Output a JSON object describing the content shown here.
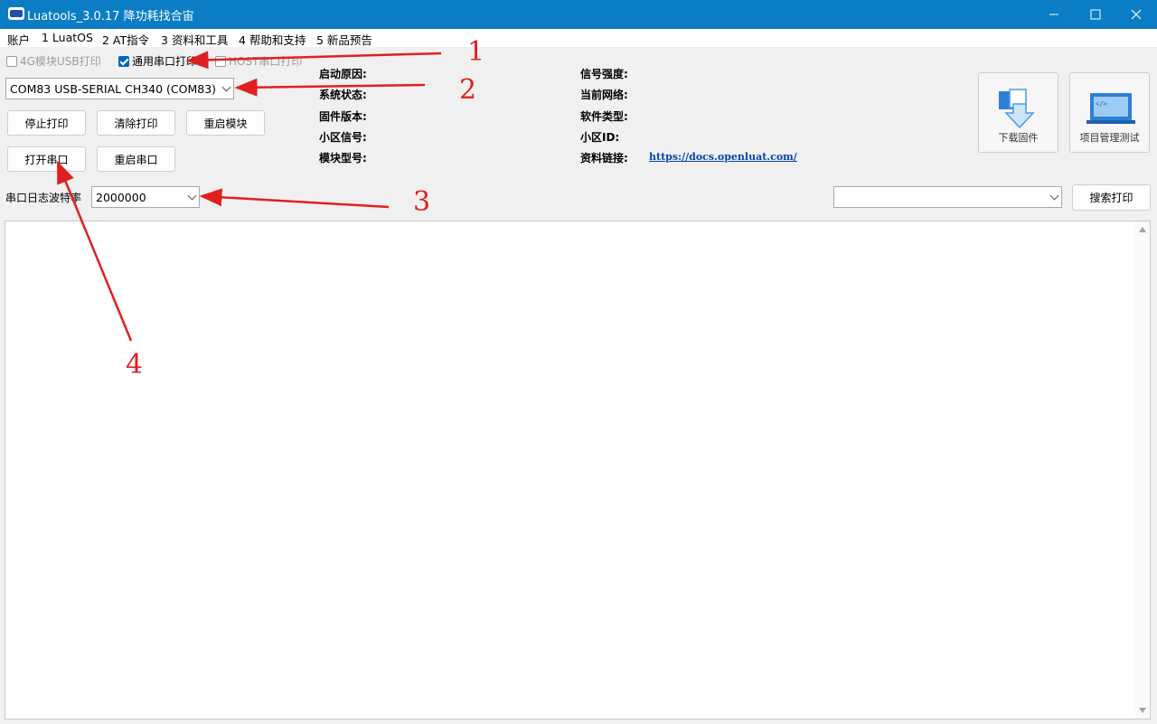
{
  "window": {
    "title": "Luatools_3.0.17 降功耗找合宙",
    "controls": [
      "minimize-icon",
      "maximize-icon",
      "close-icon"
    ]
  },
  "menu": [
    {
      "label": "账户"
    },
    {
      "label": "1 LuatOS"
    },
    {
      "label": "2 AT指令"
    },
    {
      "label": "3 资料和工具"
    },
    {
      "label": "4 帮助和支持"
    },
    {
      "label": "5 新品预告"
    }
  ],
  "print_options": {
    "usb_4g": {
      "label": "4G模块USB打印",
      "checked": false,
      "enabled": false
    },
    "generic_serial": {
      "label": "通用串口打印",
      "checked": true,
      "enabled": true
    },
    "host_serial": {
      "label": "HOST串口打印",
      "checked": false,
      "enabled": false
    }
  },
  "port_select": {
    "value": "COM83 USB-SERIAL CH340 (COM83)",
    "refresh_icon": "refresh-icon"
  },
  "buttons": {
    "stop_print": "停止打印",
    "clear_print": "清除打印",
    "restart_module": "重启模块",
    "open_port": "打开串口",
    "restart_port": "重启串口",
    "search_print": "搜索打印",
    "download_firmware": "下载固件",
    "project_test": "项目管理测试"
  },
  "baud": {
    "label": "串口日志波特率",
    "value": "2000000"
  },
  "search_combo": {
    "value": ""
  },
  "info": {
    "left": [
      {
        "label": "启动原因:",
        "value": ""
      },
      {
        "label": "系统状态:",
        "value": ""
      },
      {
        "label": "固件版本:",
        "value": ""
      },
      {
        "label": "小区信号:",
        "value": ""
      },
      {
        "label": "模块型号:",
        "value": ""
      }
    ],
    "right": [
      {
        "label": "信号强度:",
        "value": ""
      },
      {
        "label": "当前网络:",
        "value": ""
      },
      {
        "label": "软件类型:",
        "value": ""
      },
      {
        "label": "小区ID:",
        "value": ""
      },
      {
        "label": "资料链接:",
        "value": "https://docs.openluat.com/"
      }
    ]
  },
  "annotations": [
    "1",
    "2",
    "3",
    "4"
  ],
  "colors": {
    "titlebar": "#0b7dc4",
    "accent": "#0067c0",
    "annotation": "#e02020",
    "link": "#0645ad"
  }
}
